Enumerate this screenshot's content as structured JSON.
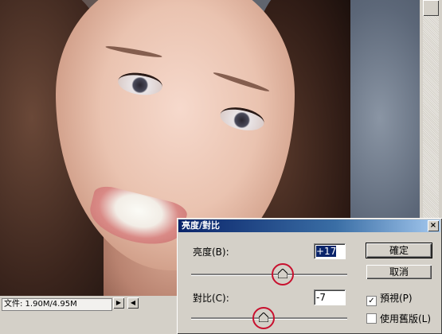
{
  "dialog": {
    "title": "亮度/對比",
    "close": "×",
    "brightness": {
      "label": "亮度(B):",
      "value": "+17",
      "level": 17
    },
    "contrast": {
      "label": "對比(C):",
      "value": "-7",
      "level": -7
    },
    "buttons": {
      "ok": "確定",
      "cancel": "取消"
    },
    "preview": {
      "label": "預視(P)",
      "checked": true,
      "mark": "✓"
    },
    "legacy": {
      "label": "使用舊版(L)",
      "checked": false
    }
  },
  "status": {
    "doc_size": "文件: 1.90M/4.95M",
    "next_arrow": "▶",
    "prev_arrow": "◀"
  },
  "accent": {
    "titlebar": "#0a246a",
    "highlight_ring": "#c8102e"
  }
}
